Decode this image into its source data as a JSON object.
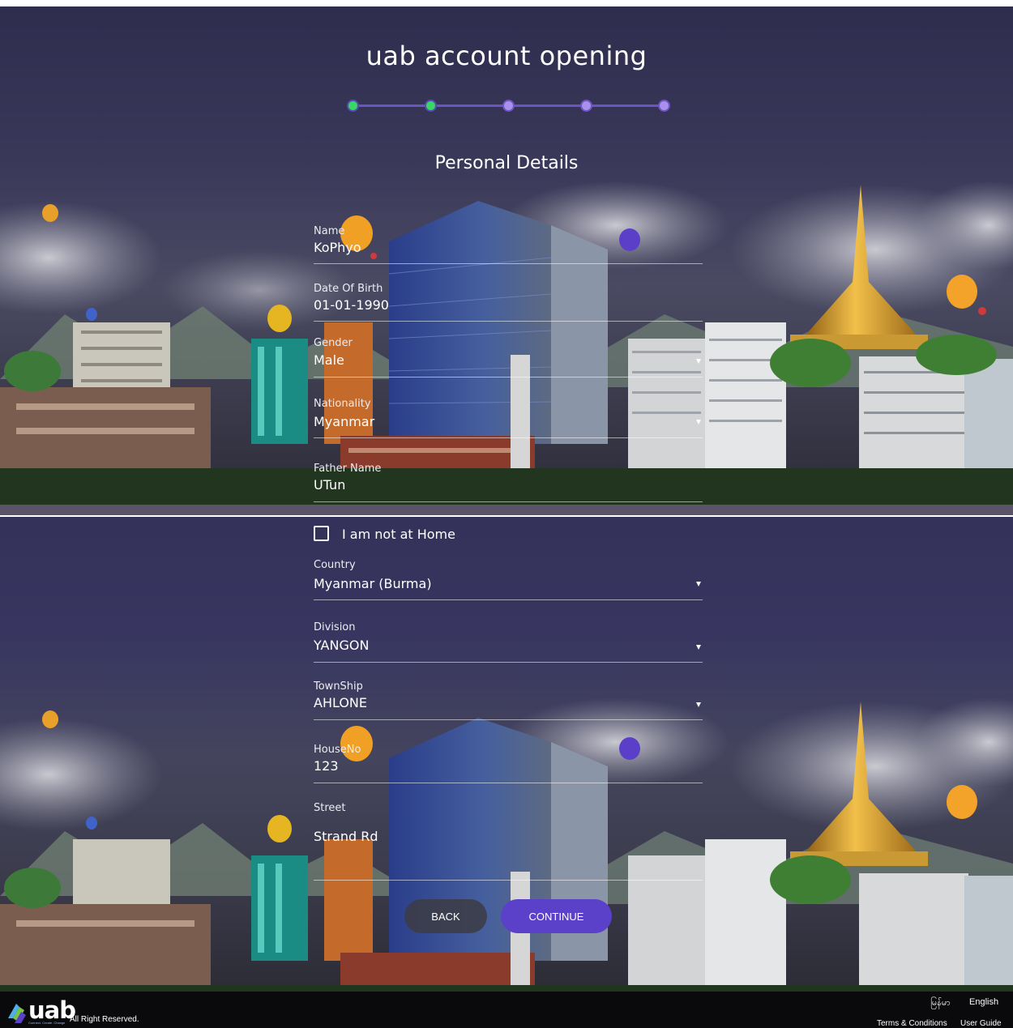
{
  "header": {
    "title": "uab account opening",
    "section_title": "Personal Details"
  },
  "stepper": {
    "total_steps": 5,
    "completed_steps": 2,
    "colors": {
      "done": "#3ad567",
      "pending": "#a990ea",
      "line": "#6a56c2"
    }
  },
  "form": {
    "name": {
      "label": "Name",
      "value": "KoPhyo"
    },
    "dob": {
      "label": "Date Of Birth",
      "value": "01-01-1990"
    },
    "gender": {
      "label": "Gender",
      "value": "Male"
    },
    "nationality": {
      "label": "Nationality",
      "value": "Myanmar"
    },
    "father_name": {
      "label": "Father Name",
      "value": "UTun"
    },
    "not_at_home": {
      "label": "I am not at Home",
      "checked": false
    },
    "country": {
      "label": "Country",
      "value": "Myanmar (Burma)"
    },
    "division": {
      "label": "Division",
      "value": "YANGON"
    },
    "township": {
      "label": "TownShip",
      "value": "AHLONE"
    },
    "house_no": {
      "label": "HouseNo",
      "value": "123"
    },
    "street": {
      "label": "Street",
      "value": "Strand Rd"
    }
  },
  "buttons": {
    "back": "BACK",
    "continue": "CONTINUE"
  },
  "footer": {
    "brand": "uab",
    "tagline": "Connect. Create. Change",
    "copyright": "All Right Reserved.",
    "lang_myanmar": "မြန်မာ",
    "lang_english": "English",
    "terms": "Terms & Conditions",
    "guide": "User Guide"
  },
  "colors": {
    "accent": "#5b40c9",
    "back_button": "#3c3c46",
    "footer_bg": "#0a0a0d"
  }
}
